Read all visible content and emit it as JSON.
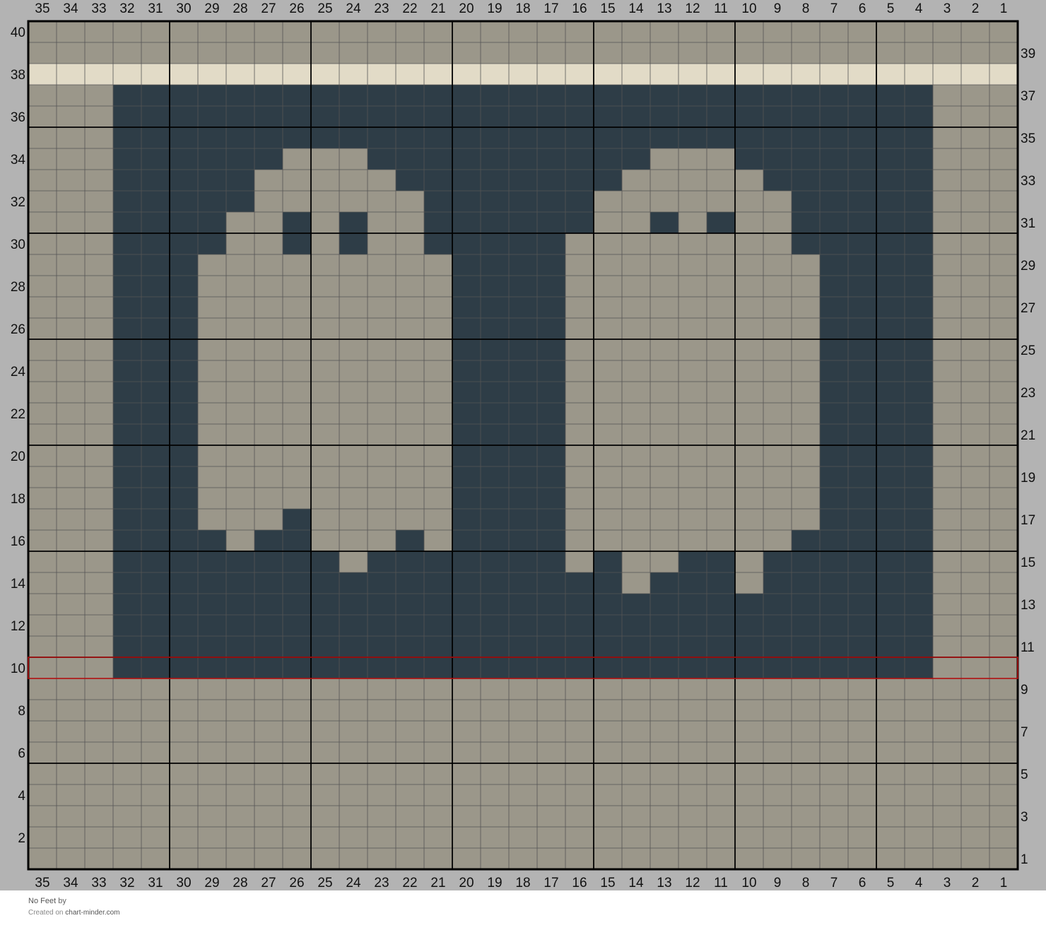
{
  "chart": {
    "columns": 35,
    "rows": 40,
    "colors": {
      "background": "#9b978a",
      "contrast": "#2e3d47",
      "highlight": "#e2dbc7",
      "page": "#b3b3b3",
      "grid_fine": "#555555",
      "grid_major": "#000000",
      "marker": "#b01010"
    },
    "highlight_rows": [
      38
    ],
    "marked_row": 10,
    "major_grid_every": 5,
    "pattern_rows": {
      "15": [
        4,
        5,
        6,
        7,
        8,
        9,
        11,
        12,
        15,
        17,
        18,
        19,
        20,
        21,
        22,
        23,
        25,
        26,
        27,
        28,
        29,
        30,
        31,
        32
      ],
      "16": [
        4,
        5,
        6,
        7,
        8,
        17,
        18,
        19,
        20,
        22,
        26,
        27,
        29,
        30,
        31,
        32
      ],
      "17": [
        4,
        5,
        6,
        7,
        17,
        18,
        19,
        20,
        26,
        30,
        31,
        32
      ],
      "18": [
        4,
        5,
        6,
        7,
        17,
        18,
        19,
        20,
        30,
        31,
        32
      ],
      "19": [
        4,
        5,
        6,
        7,
        17,
        18,
        19,
        20,
        30,
        31,
        32
      ],
      "20": [
        4,
        5,
        6,
        7,
        17,
        18,
        19,
        20,
        30,
        31,
        32
      ],
      "21": [
        4,
        5,
        6,
        7,
        17,
        18,
        19,
        20,
        30,
        31,
        32
      ],
      "22": [
        4,
        5,
        6,
        7,
        17,
        18,
        19,
        20,
        30,
        31,
        32
      ],
      "23": [
        4,
        5,
        6,
        7,
        17,
        18,
        19,
        20,
        30,
        31,
        32
      ],
      "24": [
        4,
        5,
        6,
        7,
        17,
        18,
        19,
        20,
        30,
        31,
        32
      ],
      "25": [
        4,
        5,
        6,
        7,
        17,
        18,
        19,
        20,
        30,
        31,
        32
      ],
      "26": [
        4,
        5,
        6,
        7,
        17,
        18,
        19,
        20,
        30,
        31,
        32
      ],
      "27": [
        4,
        5,
        6,
        7,
        17,
        18,
        19,
        20,
        30,
        31,
        32
      ],
      "28": [
        4,
        5,
        6,
        7,
        17,
        18,
        19,
        20,
        30,
        31,
        32
      ],
      "29": [
        4,
        5,
        6,
        7,
        17,
        18,
        19,
        20,
        30,
        31,
        32
      ],
      "30": [
        4,
        5,
        6,
        7,
        8,
        17,
        18,
        19,
        20,
        21,
        26,
        24,
        29,
        30,
        31,
        32
      ],
      "31": [
        4,
        5,
        6,
        7,
        8,
        11,
        13,
        16,
        17,
        18,
        19,
        20,
        21,
        24,
        26,
        29,
        30,
        31,
        32
      ],
      "32": [
        4,
        5,
        6,
        7,
        8,
        16,
        17,
        18,
        19,
        20,
        21,
        28,
        29,
        30,
        31,
        32
      ],
      "33": [
        4,
        5,
        6,
        7,
        8,
        9,
        15,
        16,
        17,
        18,
        19,
        20,
        21,
        22,
        28,
        29,
        30,
        31,
        32
      ],
      "34": [
        4,
        5,
        6,
        7,
        8,
        9,
        10,
        14,
        15,
        16,
        17,
        18,
        19,
        20,
        21,
        22,
        23,
        27,
        28,
        29,
        30,
        31,
        32
      ]
    },
    "solid_row_ranges": {
      "10-14": [
        4,
        32
      ],
      "35-37": [
        4,
        32
      ]
    },
    "row14_light": [
      10,
      14
    ],
    "row15_light": [
      9,
      10,
      11,
      13,
      14,
      16,
      24
    ],
    "row14_dark_fix": true
  },
  "footer": {
    "title": "No Feet",
    "by": "by",
    "created_on": "Created on",
    "site": "chart-minder.com"
  }
}
